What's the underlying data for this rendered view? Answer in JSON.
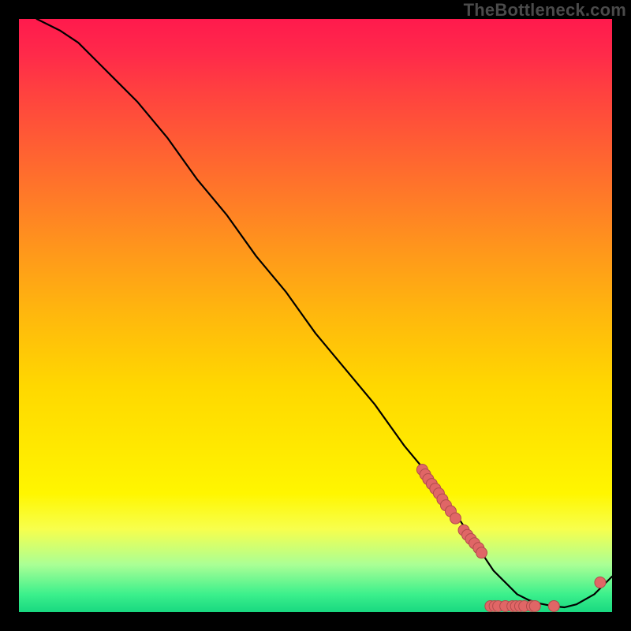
{
  "watermark": "TheBottleneck.com",
  "colors": {
    "line": "#000000",
    "dot_fill": "#e06666",
    "dot_stroke": "#b24c4c"
  },
  "chart_data": {
    "type": "line",
    "title": "",
    "xlabel": "",
    "ylabel": "",
    "xlim": [
      0,
      100
    ],
    "ylim": [
      0,
      100
    ],
    "grid": false,
    "series": [
      {
        "name": "curve",
        "x": [
          3,
          5,
          7,
          10,
          13,
          16,
          20,
          25,
          30,
          35,
          40,
          45,
          50,
          55,
          60,
          65,
          70,
          74,
          78,
          80,
          82,
          84,
          86,
          88,
          90,
          92,
          94,
          97,
          100
        ],
        "y": [
          100,
          99,
          98,
          96,
          93,
          90,
          86,
          80,
          73,
          67,
          60,
          54,
          47,
          41,
          35,
          28,
          22,
          16,
          10,
          7,
          5,
          3,
          2,
          1.4,
          1,
          0.8,
          1.3,
          3,
          6
        ]
      }
    ],
    "markers": [
      {
        "x": 68.0,
        "y": 24.0
      },
      {
        "x": 68.5,
        "y": 23.2
      },
      {
        "x": 69.0,
        "y": 22.4
      },
      {
        "x": 69.6,
        "y": 21.6
      },
      {
        "x": 70.2,
        "y": 20.8
      },
      {
        "x": 70.8,
        "y": 20.0
      },
      {
        "x": 71.4,
        "y": 19.0
      },
      {
        "x": 72.0,
        "y": 18.0
      },
      {
        "x": 72.8,
        "y": 17.0
      },
      {
        "x": 73.6,
        "y": 15.8
      },
      {
        "x": 75.0,
        "y": 13.8
      },
      {
        "x": 75.6,
        "y": 13.0
      },
      {
        "x": 76.2,
        "y": 12.3
      },
      {
        "x": 76.8,
        "y": 11.6
      },
      {
        "x": 77.5,
        "y": 10.8
      },
      {
        "x": 78.0,
        "y": 10.0
      },
      {
        "x": 79.5,
        "y": 1.0
      },
      {
        "x": 80.2,
        "y": 1.0
      },
      {
        "x": 80.8,
        "y": 1.0
      },
      {
        "x": 82.0,
        "y": 1.0
      },
      {
        "x": 83.2,
        "y": 1.0
      },
      {
        "x": 83.8,
        "y": 1.0
      },
      {
        "x": 84.5,
        "y": 1.0
      },
      {
        "x": 85.2,
        "y": 1.0
      },
      {
        "x": 86.5,
        "y": 1.0
      },
      {
        "x": 87.0,
        "y": 1.0
      },
      {
        "x": 90.2,
        "y": 1.0
      },
      {
        "x": 98.0,
        "y": 5.0
      }
    ]
  }
}
